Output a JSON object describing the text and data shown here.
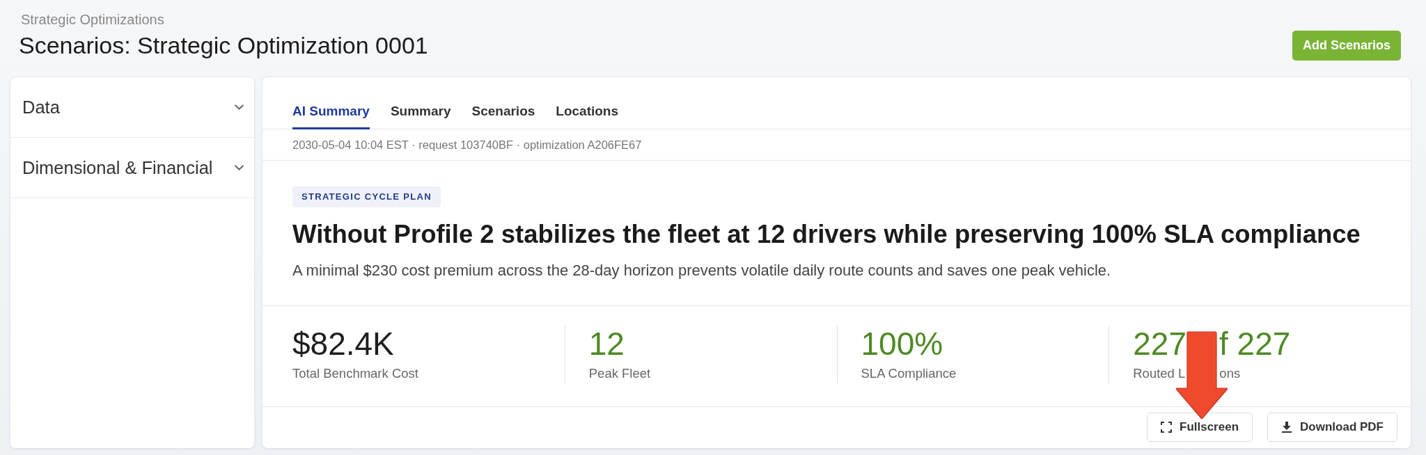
{
  "header": {
    "breadcrumb": "Strategic Optimizations",
    "title": "Scenarios: Strategic Optimization 0001",
    "action": "Add Scenarios"
  },
  "sidebar": {
    "items": [
      {
        "label": "Data",
        "expanded": false
      },
      {
        "label": "Dimensional & Financial",
        "expanded": false
      }
    ]
  },
  "tabs": [
    {
      "label": "AI Summary",
      "selected": true
    },
    {
      "label": "Summary",
      "selected": false
    },
    {
      "label": "Scenarios",
      "selected": false
    },
    {
      "label": "Locations",
      "selected": false
    }
  ],
  "meta": "2030-05-04 10:04 EST · request 103740BF · optimization A206FE67",
  "summary": {
    "tag": "STRATEGIC CYCLE PLAN",
    "headline": "Without Profile 2 stabilizes the fleet at 12 drivers while preserving 100% SLA compliance",
    "description": "A minimal $230 cost premium across the 28-day horizon prevents volatile daily route counts and saves one peak vehicle."
  },
  "metrics": [
    {
      "value_parts": [
        "$82.4K"
      ],
      "label_parts": [
        "Total Benchmark Cost"
      ],
      "color": "#1e1e1e",
      "arrow": false
    },
    {
      "value_parts": [
        "12"
      ],
      "label_parts": [
        "Peak Fleet"
      ],
      "color": "#4e8a24",
      "arrow": false
    },
    {
      "value_parts": [
        "100%"
      ],
      "label_parts": [
        "SLA Compliance"
      ],
      "color": "#4e8a24",
      "arrow": false
    },
    {
      "value_parts": [
        "227",
        "f 227"
      ],
      "label_parts": [
        "Routed L",
        "ons"
      ],
      "color": "#4e8a24",
      "arrow": true
    }
  ],
  "actions": [
    {
      "label": "Fullscreen",
      "kind": "fullscreen"
    },
    {
      "label": "Download PDF",
      "kind": "download"
    }
  ]
}
